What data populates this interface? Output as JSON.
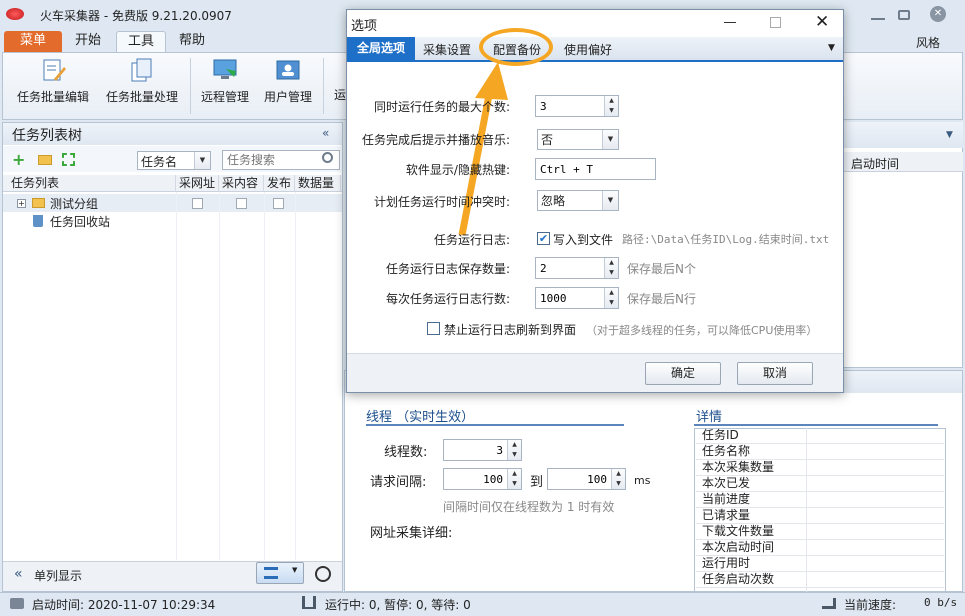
{
  "app": {
    "title": "火车采集器 - 免费版 9.21.20.0907",
    "tabs": [
      "菜单",
      "开始",
      "工具",
      "帮助"
    ],
    "style_label": "风格"
  },
  "ribbon": {
    "buttons": [
      "任务批量编辑",
      "任务批量处理",
      "远程管理",
      "用户管理"
    ],
    "partial_label": "运"
  },
  "left_panel": {
    "title": "任务列表树",
    "filter_select": "任务名",
    "search_placeholder": "任务搜索",
    "columns": [
      "任务列表",
      "采网址",
      "采内容",
      "发布",
      "数据量"
    ],
    "tree": [
      "测试分组",
      "任务回收站"
    ],
    "bottom_label": "单列显示"
  },
  "right_grid": {
    "header": "启动时间"
  },
  "thread_panel": {
    "title": "线程 （实时生效）",
    "threads_label": "线程数:",
    "threads_value": "3",
    "interval_label": "请求间隔:",
    "interval_from": "100",
    "to_label": "到",
    "interval_to": "100",
    "unit": "ms",
    "hint": "间隔时间仅在线程数为 1 时有效",
    "detail_label": "网址采集详细:"
  },
  "details": {
    "title": "详情",
    "rows": [
      "任务ID",
      "任务名称",
      "本次采集数量",
      "本次已发",
      "当前进度",
      "已请求量",
      "下载文件数量",
      "本次启动时间",
      "运行用时",
      "任务启动次数"
    ]
  },
  "statusbar": {
    "start_time": "启动时间: 2020-11-07 10:29:34",
    "running": "运行中: 0, 暂停: 0, 等待: 0",
    "speed_label": "当前速度:",
    "speed_value": "0 b/s"
  },
  "dialog": {
    "title": "选项",
    "tabs": [
      "全局选项",
      "采集设置",
      "配置备份",
      "使用偏好"
    ],
    "fields": {
      "max_tasks_label": "同时运行任务的最大个数:",
      "max_tasks_value": "3",
      "notify_label": "任务完成后提示并播放音乐:",
      "notify_value": "否",
      "hotkey_label": "软件显示/隐藏热键:",
      "hotkey_value": "Ctrl + T",
      "conflict_label": "计划任务运行时间冲突时:",
      "conflict_value": "忽略",
      "log_label": "任务运行日志:",
      "log_checkbox": "写入到文件",
      "log_path": "路径:\\Data\\任务ID\\Log.结束时间.txt",
      "log_keep_label": "任务运行日志保存数量:",
      "log_keep_value": "2",
      "log_keep_hint": "保存最后N个",
      "log_lines_label": "每次任务运行日志行数:",
      "log_lines_value": "1000",
      "log_lines_hint": "保存最后N行",
      "disable_refresh": "禁止运行日志刷新到界面",
      "disable_refresh_hint": "（对于超多线程的任务，可以降低CPU使用率）"
    },
    "ok": "确定",
    "cancel": "取消"
  },
  "colors": {
    "accent_orange": "#f5a623",
    "menu_tab": "#e36b2c",
    "selected_blue": "#1e6fc8"
  }
}
